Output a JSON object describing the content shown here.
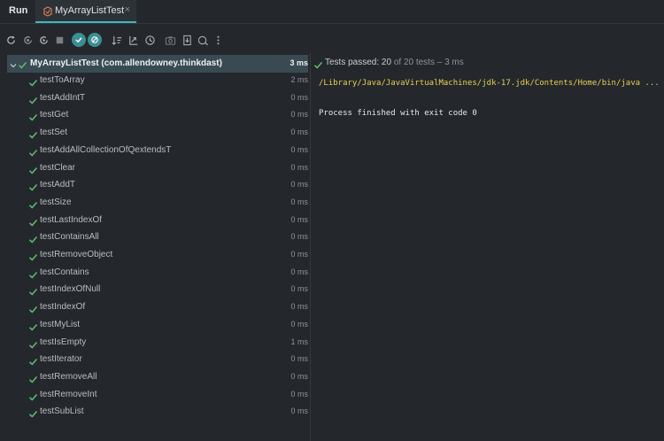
{
  "tabbar": {
    "run_label": "Run",
    "tab_title": "MyArrayListTest",
    "close_glyph": "×"
  },
  "toolbar": {
    "icons": [
      "rerun-icon",
      "rerun-failed-icon",
      "rerun-auto-icon",
      "stop-icon",
      "show-passed-icon",
      "show-ignored-icon",
      "sort-alpha-icon",
      "sort-duration-icon",
      "history-icon",
      "screenshot-icon",
      "import-icon",
      "export-icon",
      "more-icon"
    ]
  },
  "tree": {
    "root": {
      "name": "MyArrayListTest (com.allendowney.thinkdast)",
      "time": "3 ms"
    },
    "tests": [
      {
        "name": "testToArray",
        "time": "2 ms"
      },
      {
        "name": "testAddIntT",
        "time": "0 ms"
      },
      {
        "name": "testGet",
        "time": "0 ms"
      },
      {
        "name": "testSet",
        "time": "0 ms"
      },
      {
        "name": "testAddAllCollectionOfQextendsT",
        "time": "0 ms"
      },
      {
        "name": "testClear",
        "time": "0 ms"
      },
      {
        "name": "testAddT",
        "time": "0 ms"
      },
      {
        "name": "testSize",
        "time": "0 ms"
      },
      {
        "name": "testLastIndexOf",
        "time": "0 ms"
      },
      {
        "name": "testContainsAll",
        "time": "0 ms"
      },
      {
        "name": "testRemoveObject",
        "time": "0 ms"
      },
      {
        "name": "testContains",
        "time": "0 ms"
      },
      {
        "name": "testIndexOfNull",
        "time": "0 ms"
      },
      {
        "name": "testIndexOf",
        "time": "0 ms"
      },
      {
        "name": "testMyList",
        "time": "0 ms"
      },
      {
        "name": "testIsEmpty",
        "time": "1 ms"
      },
      {
        "name": "testIterator",
        "time": "0 ms"
      },
      {
        "name": "testRemoveAll",
        "time": "0 ms"
      },
      {
        "name": "testRemoveInt",
        "time": "0 ms"
      },
      {
        "name": "testSubList",
        "time": "0 ms"
      }
    ]
  },
  "status": {
    "prefix": "Tests passed: ",
    "passed": "20",
    "suffix": " of 20 tests – 3 ms"
  },
  "console": {
    "command": "/Library/Java/JavaVirtualMachines/jdk-17.jdk/Contents/Home/bin/java ...",
    "exit_message": "Process finished with exit code 0"
  },
  "colors": {
    "background": "#24282c",
    "accent": "#3fb8c3",
    "pass": "#5fb86e",
    "selected_row": "#394a52",
    "command_text": "#e8d04f"
  }
}
